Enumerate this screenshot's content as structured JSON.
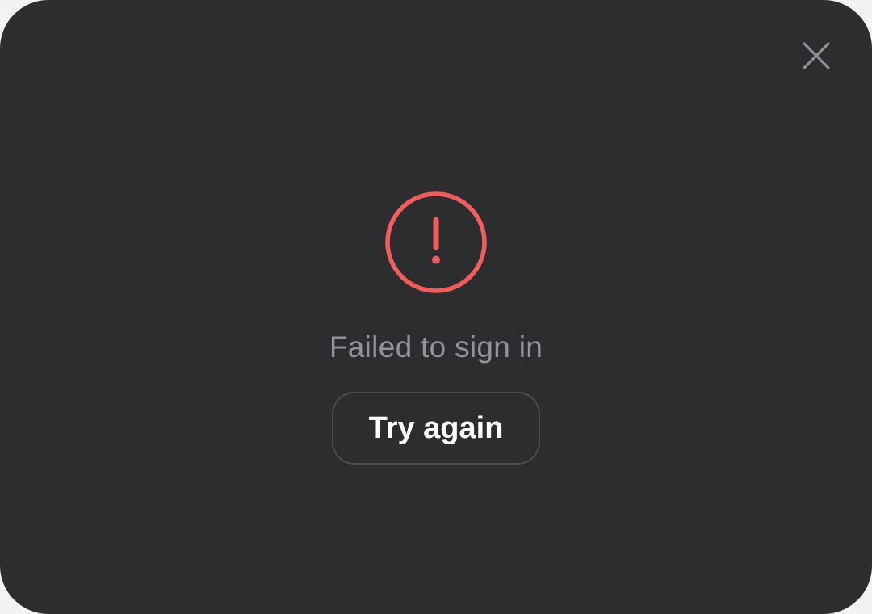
{
  "dialog": {
    "message": "Failed to sign in",
    "retry_label": "Try again",
    "close_icon": "close-icon",
    "status_icon": "error-circle-icon"
  },
  "colors": {
    "background": "#2c2d2f",
    "error_accent": "#f25c5c",
    "message_text": "#919398",
    "button_text": "#ffffff",
    "button_border": "#4b4c50",
    "close_icon": "#8e9096"
  }
}
